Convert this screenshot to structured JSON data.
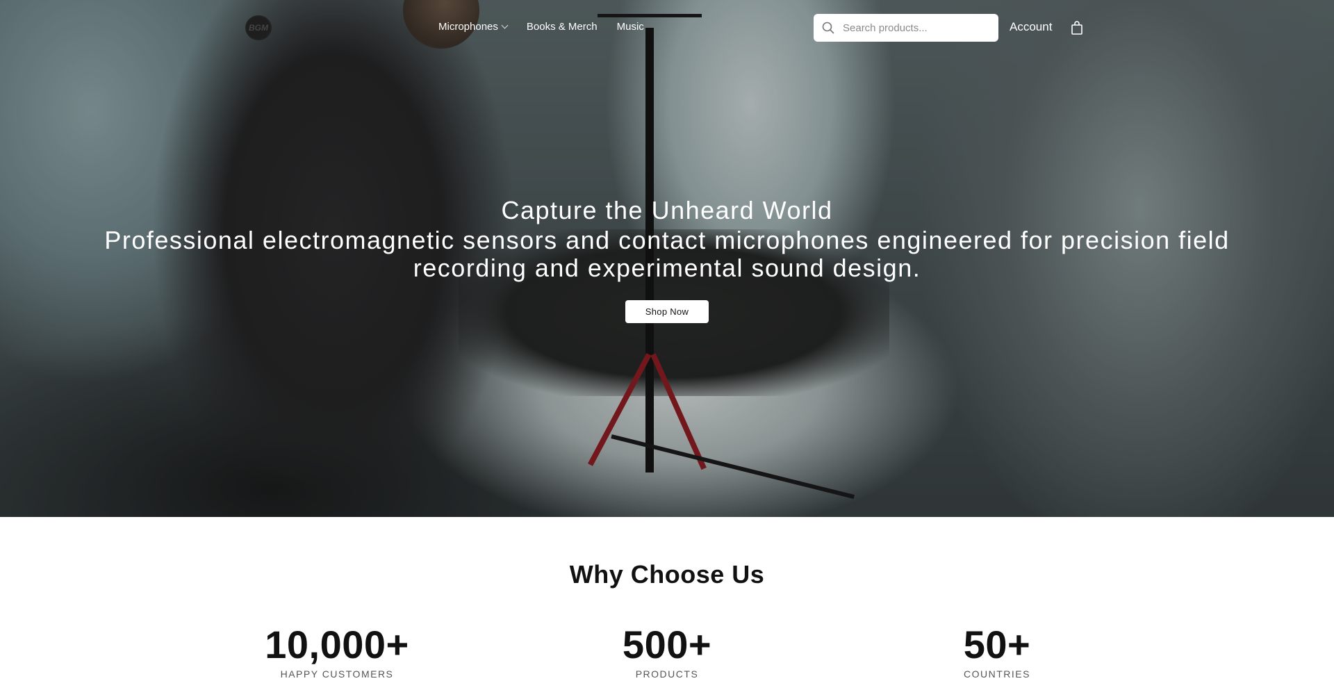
{
  "nav": {
    "logo_text": "BGM",
    "links": [
      {
        "label": "Microphones"
      },
      {
        "label": "Books & Merch"
      },
      {
        "label": "Music"
      }
    ],
    "search_placeholder": "Search products...",
    "account_label": "Account"
  },
  "hero": {
    "title": "Capture the Unheard World",
    "subtitle": "Professional electromagnetic sensors and contact microphones engineered for precision field recording and experimental sound design.",
    "cta_label": "Shop Now"
  },
  "why": {
    "title": "Why Choose Us",
    "stats": [
      {
        "value": "10,000+",
        "label": "HAPPY CUSTOMERS"
      },
      {
        "value": "500+",
        "label": "PRODUCTS"
      },
      {
        "value": "50+",
        "label": "COUNTRIES"
      }
    ]
  }
}
